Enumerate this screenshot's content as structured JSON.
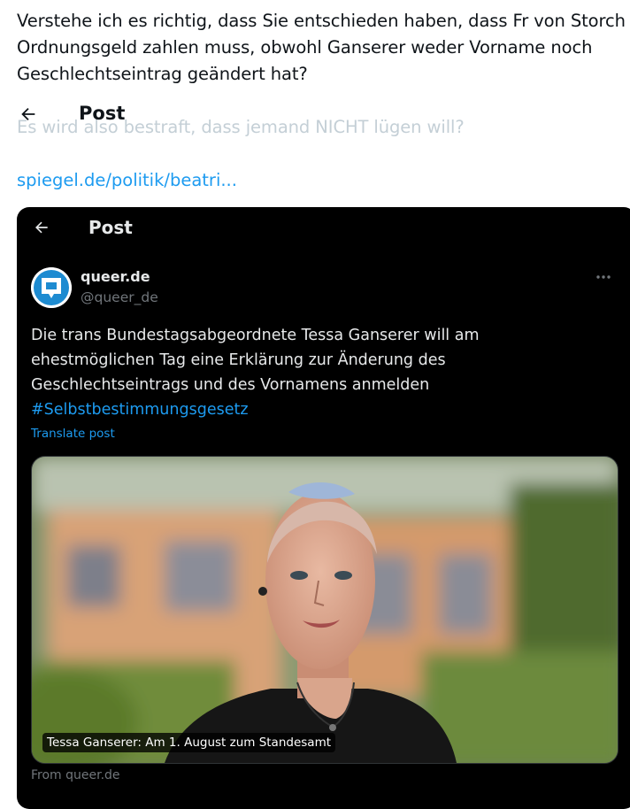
{
  "tweet": {
    "lines": [
      "Verstehe ich es richtig, dass Sie entschieden haben, dass Fr von Storch",
      "Ordnungsgeld zahlen muss, obwohl Ganserer weder Vorname noch",
      "Geschlechtseintrag geändert hat?"
    ],
    "faded_line": "Es wird also bestraft, dass jemand NICHT lügen will?",
    "link": "spiegel.de/politik/beatri..."
  },
  "header": {
    "title": "Post",
    "back_icon": "arrow-left-icon"
  },
  "embedded_post": {
    "header_title": "Post",
    "display_name": "queer.de",
    "handle": "@queer_de",
    "text_lines": [
      "Die trans Bundestagsabgeordnete Tessa Ganserer will am",
      "ehestmöglichen Tag eine Erklärung zur Änderung des",
      "Geschlechtseintrags und des Vornamens anmelden"
    ],
    "hashtag": "#Selbstbestimmungsgesetz",
    "translate_label": "Translate post",
    "image_caption": "Tessa Ganserer: Am 1. August zum Standesamt",
    "source": "From queer.de",
    "more_icon": "more-horizontal-icon",
    "avatar_color": "#1d8bd1"
  },
  "colors": {
    "link": "#1d9bf0",
    "embed_background": "#000000",
    "faded_text": "#c4cfd6"
  }
}
